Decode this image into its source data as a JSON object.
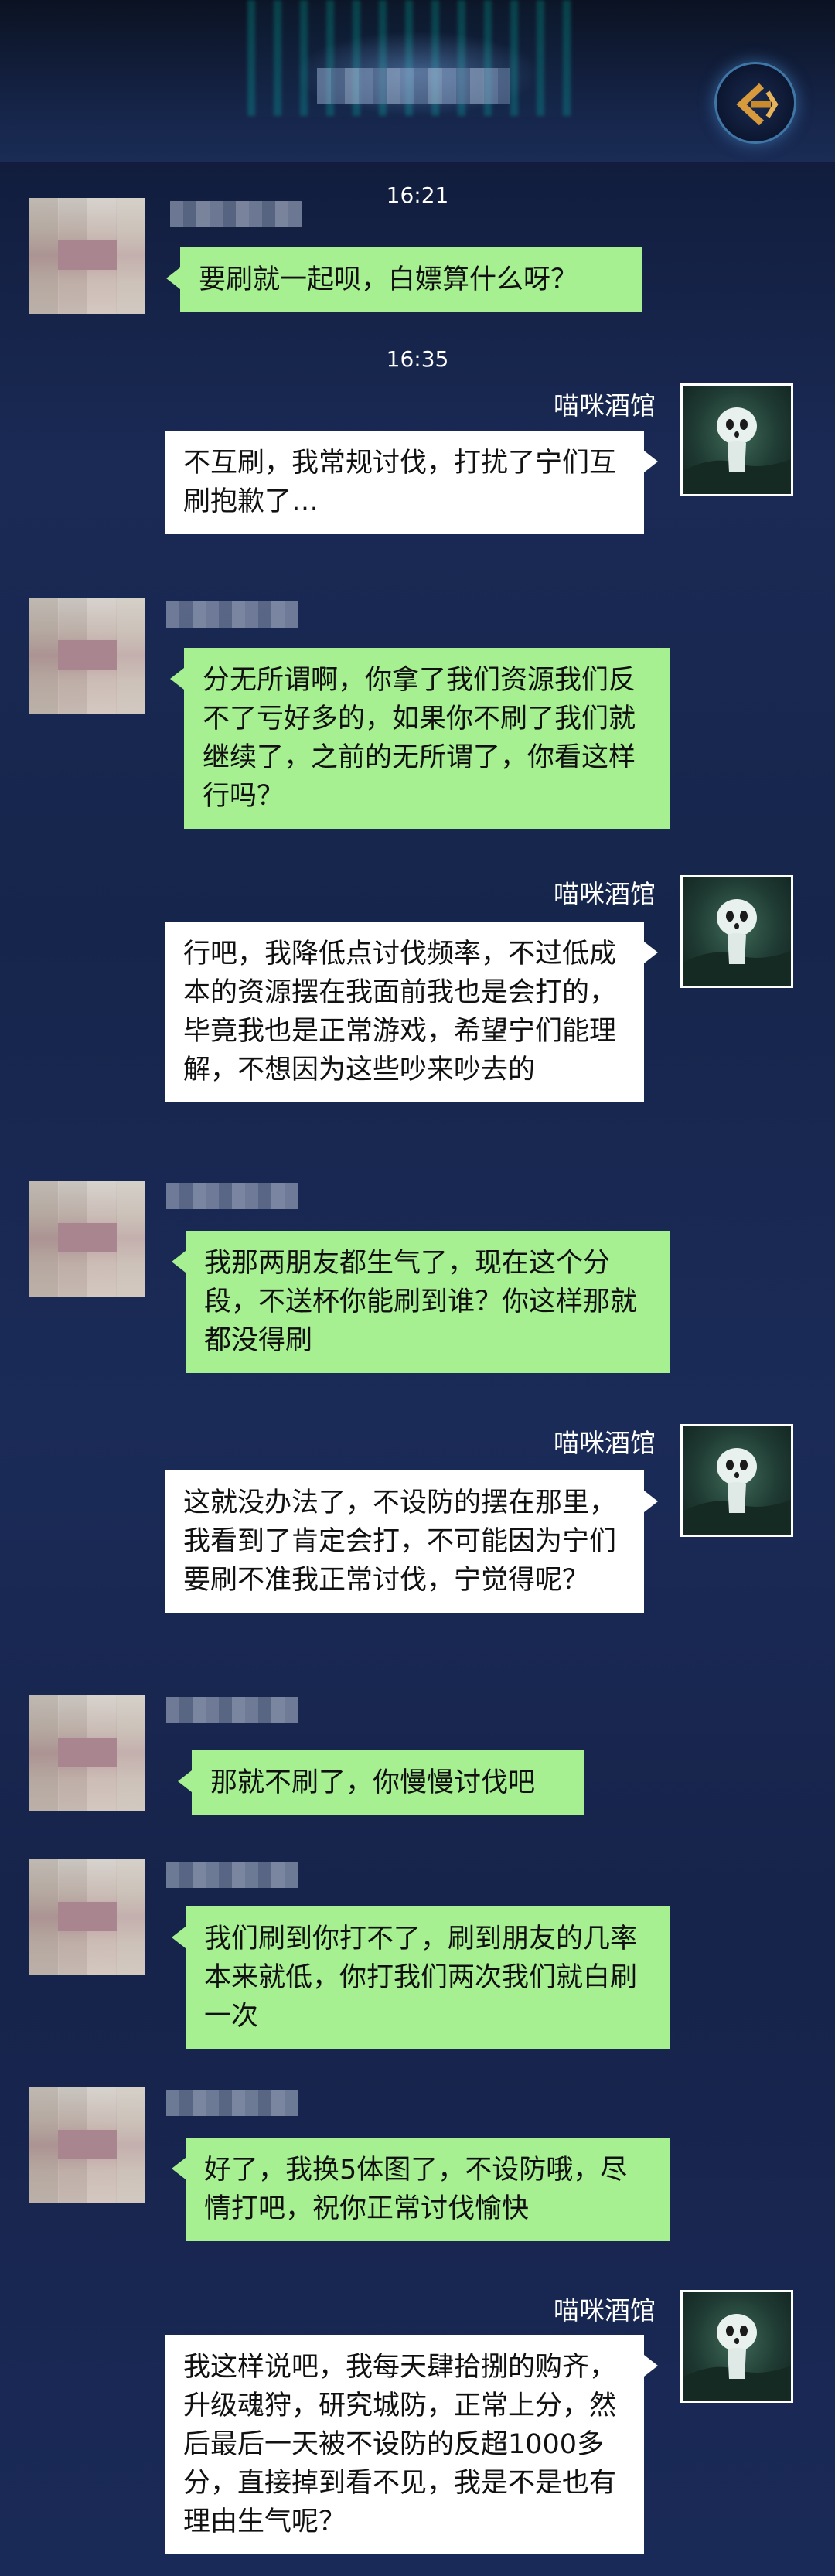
{
  "contact_name": "喵咪酒馆",
  "messages": [
    {
      "side": "time",
      "text": "16:21"
    },
    {
      "side": "left",
      "text": "要刷就一起呗，白嫖算什么呀？"
    },
    {
      "side": "time",
      "text": "16:35"
    },
    {
      "side": "right",
      "name": "喵咪酒馆",
      "text": "不互刷，我常规讨伐，打扰了宁们互刷抱歉了…"
    },
    {
      "side": "left",
      "text": "分无所谓啊，你拿了我们资源我们反不了亏好多的，如果你不刷了我们就继续了，之前的无所谓了，你看这样行吗？"
    },
    {
      "side": "right",
      "name": "喵咪酒馆",
      "text": "行吧，我降低点讨伐频率，不过低成本的资源摆在我面前我也是会打的，毕竟我也是正常游戏，希望宁们能理解，不想因为这些吵来吵去的"
    },
    {
      "side": "left",
      "text": "我那两朋友都生气了，现在这个分段，不送杯你能刷到谁？你这样那就都没得刷"
    },
    {
      "side": "right",
      "name": "喵咪酒馆",
      "text": "这就没办法了，不设防的摆在那里，我看到了肯定会打，不可能因为宁们要刷不准我正常讨伐，宁觉得呢？"
    },
    {
      "side": "left",
      "text": "那就不刷了，你慢慢讨伐吧"
    },
    {
      "side": "left",
      "text": "我们刷到你打不了，刷到朋友的几率本来就低，你打我们两次我们就白刷一次"
    },
    {
      "side": "left",
      "text": "好了，我换5体图了，不设防哦，尽情打吧，祝你正常讨伐愉快"
    },
    {
      "side": "right",
      "name": "喵咪酒馆",
      "text": "我这样说吧，我每天肆拾捌的购齐，升级魂狩，研究城防，正常上分，然后最后一天被不设防的反超1000多分，直接掉到看不见，我是不是也有理由生气呢？"
    }
  ],
  "colors": {
    "left_bubble": "#a7f091",
    "right_bubble": "#ffffff",
    "background": "#1a2a55"
  }
}
